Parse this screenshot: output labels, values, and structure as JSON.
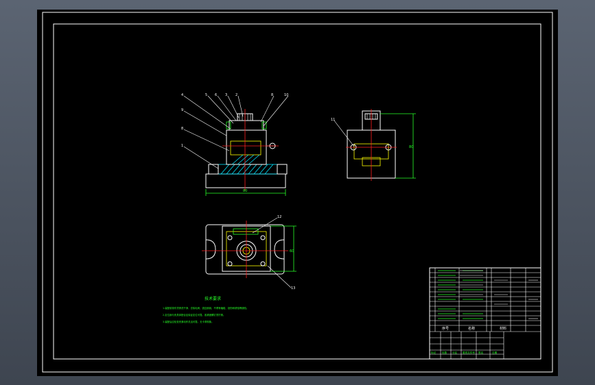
{
  "drawing": {
    "main_view": {
      "balloons": [
        "4",
        "5",
        "6",
        "3",
        "2",
        "8",
        "10",
        "9",
        "8",
        "1"
      ],
      "dimension": "80"
    },
    "side_view": {
      "balloons": [
        "11"
      ],
      "dimension": "80"
    },
    "top_view": {
      "balloons": [
        "12",
        "13"
      ],
      "dimension": "60"
    },
    "notes": {
      "title": "技术要求",
      "lines": [
        "1.装配前零件须清洗干净，去除毛刺、锐边倒钝，不得有磕碰、划伤和锈蚀等缺陷。",
        "2.定位销与夹具体配合应保证定位可靠，各紧固螺钉须拧紧。",
        "3.装配后应检查夹紧动作灵活可靠，无卡滞现象。"
      ]
    },
    "title_block": {
      "header": [
        "序号",
        "名称",
        "材料"
      ],
      "footer_labels": [
        "标记",
        "处数",
        "分区",
        "更改文件号",
        "签名",
        "日期"
      ]
    }
  },
  "colors": {
    "background": "#000000",
    "geometry": "#ffffff",
    "centerline": "#ff2020",
    "dimension": "#28ff28",
    "hatch": "#00e5ff",
    "highlight": "#ffff00"
  }
}
